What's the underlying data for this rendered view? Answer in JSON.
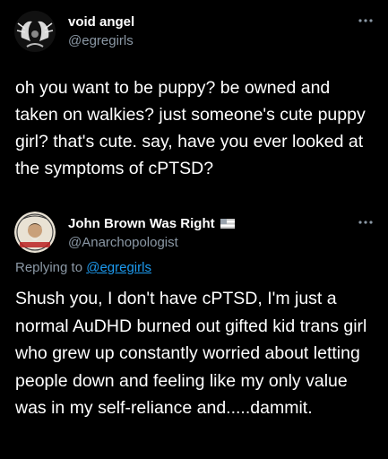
{
  "colors": {
    "background": "#000000",
    "text": "#ffffff",
    "secondary_text": "#8b98a5",
    "link": "#1d9bf0"
  },
  "tweets": [
    {
      "author_name": "void angel",
      "author_handle": "@egregirls",
      "more_icon": "more-horizontal-icon",
      "text": "oh you want to be puppy? be owned and taken on walkies? just someone's cute puppy girl? that's cute. say, have you ever looked at the symptoms of cPTSD?"
    },
    {
      "author_name": "John Brown Was Right",
      "author_handle": "@Anarchopologist",
      "name_badge_icon": "flag-icon",
      "more_icon": "more-horizontal-icon",
      "replying_prefix": "Replying to ",
      "replying_to": "@egregirls",
      "text": "Shush you, I don't have cPTSD, I'm just a normal AuDHD burned out gifted kid trans girl who grew up constantly worried about letting people down and feeling like my only value was in my self-reliance and.....dammit."
    }
  ]
}
